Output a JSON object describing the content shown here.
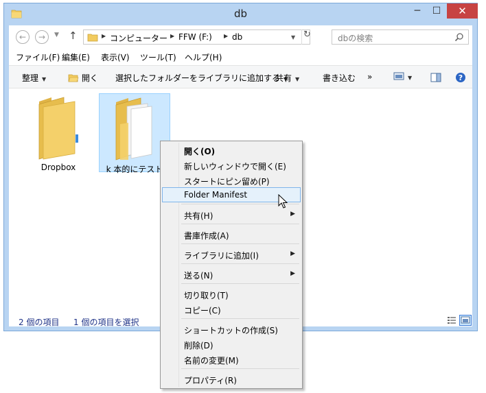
{
  "window": {
    "title": "db",
    "controls": {
      "minimize": "─",
      "maximize": "☐",
      "close": "✕"
    }
  },
  "navigation": {
    "back": "←",
    "forward": "→",
    "up": "↑",
    "breadcrumbs": [
      "コンピューター",
      "FFW (F:)",
      "db"
    ],
    "search_placeholder": "dbの検索"
  },
  "menubar": [
    "ファイル(F)",
    "編集(E)",
    "表示(V)",
    "ツール(T)",
    "ヘルプ(H)"
  ],
  "commandbar": {
    "organize": "整理",
    "open": "開く",
    "add_to_library": "選択したフォルダーをライブラリに追加する",
    "share": "共有",
    "burn": "書き込む",
    "more": "»"
  },
  "items": [
    {
      "label": "Dropbox",
      "selected": false
    },
    {
      "label": "k 本的にテスト",
      "selected": true
    }
  ],
  "status": {
    "count": "2 個の項目",
    "selection": "1 個の項目を選択"
  },
  "context_menu": [
    {
      "label": "開く(O)",
      "bold": true
    },
    {
      "label": "新しいウィンドウで開く(E)"
    },
    {
      "label": "スタートにピン留め(P)"
    },
    {
      "label": "Folder Manifest",
      "highlighted": true
    },
    {
      "label": "共有(H)",
      "submenu": true
    },
    {
      "label": "書庫作成(A)"
    },
    {
      "label": "ライブラリに追加(I)",
      "submenu": true
    },
    {
      "label": "送る(N)",
      "submenu": true
    },
    {
      "label": "切り取り(T)"
    },
    {
      "label": "コピー(C)"
    },
    {
      "label": "ショートカットの作成(S)"
    },
    {
      "label": "削除(D)"
    },
    {
      "label": "名前の変更(M)"
    },
    {
      "label": "プロパティ(R)"
    }
  ],
  "colors": {
    "window_frame": "#b8d4f2",
    "close_button": "#c74343",
    "selection_fill": "#cce8ff",
    "menu_highlight": "#e5f1fb",
    "status_text": "#1e3287",
    "folder": "#f2cb5f"
  }
}
